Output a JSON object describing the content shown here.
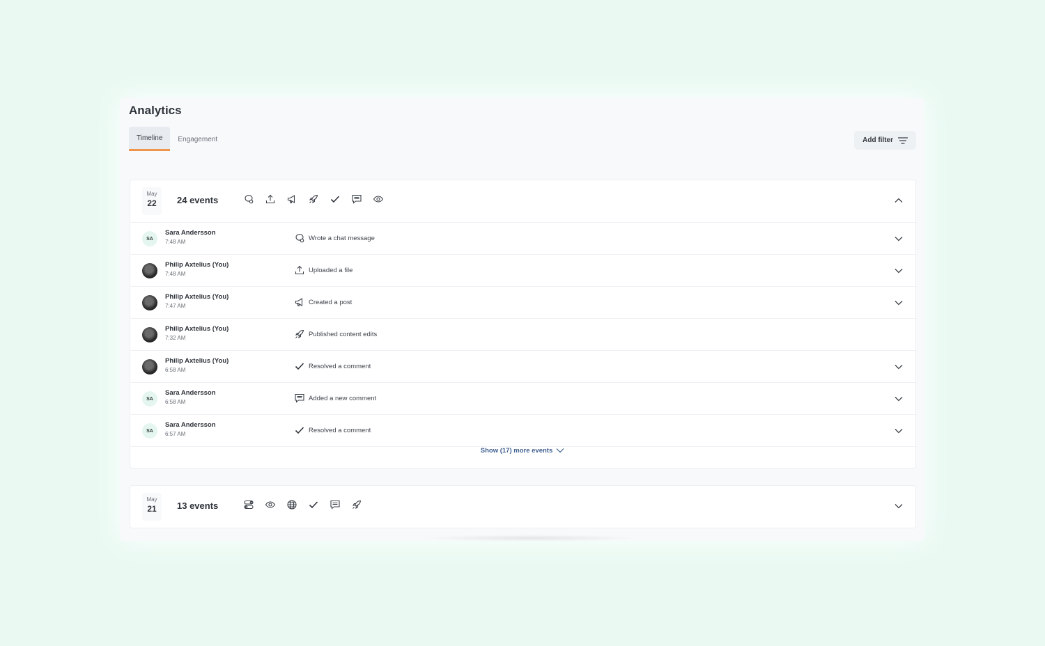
{
  "page": {
    "title": "Analytics"
  },
  "tabs": [
    {
      "label": "Timeline",
      "active": true
    },
    {
      "label": "Engagement",
      "active": false
    }
  ],
  "toolbar": {
    "add_filter_label": "Add filter"
  },
  "groups": [
    {
      "month": "May",
      "day": "22",
      "count_label": "24 events",
      "type_icons": [
        "chat-icon",
        "upload-icon",
        "megaphone-icon",
        "rocket-icon",
        "check-icon",
        "comment-icon",
        "eye-icon"
      ],
      "expanded": true,
      "events": [
        {
          "user": "Sara Andersson",
          "initials": "SA",
          "avatar": "initials",
          "time": "7:48 AM",
          "action": "Wrote a chat message",
          "icon": "chat-icon",
          "expandable": true
        },
        {
          "user": "Philip Axtelius (You)",
          "initials": "",
          "avatar": "photo",
          "time": "7:48 AM",
          "action": "Uploaded a file",
          "icon": "upload-icon",
          "expandable": true
        },
        {
          "user": "Philip Axtelius (You)",
          "initials": "",
          "avatar": "photo",
          "time": "7:47 AM",
          "action": "Created a post",
          "icon": "megaphone-icon",
          "expandable": true
        },
        {
          "user": "Philip Axtelius (You)",
          "initials": "",
          "avatar": "photo",
          "time": "7:32 AM",
          "action": "Published content edits",
          "icon": "rocket-icon",
          "expandable": false
        },
        {
          "user": "Philip Axtelius (You)",
          "initials": "",
          "avatar": "photo",
          "time": "6:58 AM",
          "action": "Resolved a comment",
          "icon": "check-icon",
          "expandable": true
        },
        {
          "user": "Sara Andersson",
          "initials": "SA",
          "avatar": "initials",
          "time": "6:58 AM",
          "action": "Added a new comment",
          "icon": "comment-icon",
          "expandable": true
        },
        {
          "user": "Sara Andersson",
          "initials": "SA",
          "avatar": "initials",
          "time": "6:57 AM",
          "action": "Resolved a comment",
          "icon": "check-icon",
          "expandable": true
        }
      ],
      "show_more_label": "Show (17) more events"
    },
    {
      "month": "May",
      "day": "21",
      "count_label": "13 events",
      "type_icons": [
        "toggle-icon",
        "eye-icon",
        "globe-icon",
        "check-icon",
        "comment-icon",
        "rocket-icon"
      ],
      "expanded": false
    }
  ],
  "colors": {
    "background": "#eafaf3",
    "tab_accent": "#f0934b",
    "link": "#3f5f8f"
  }
}
